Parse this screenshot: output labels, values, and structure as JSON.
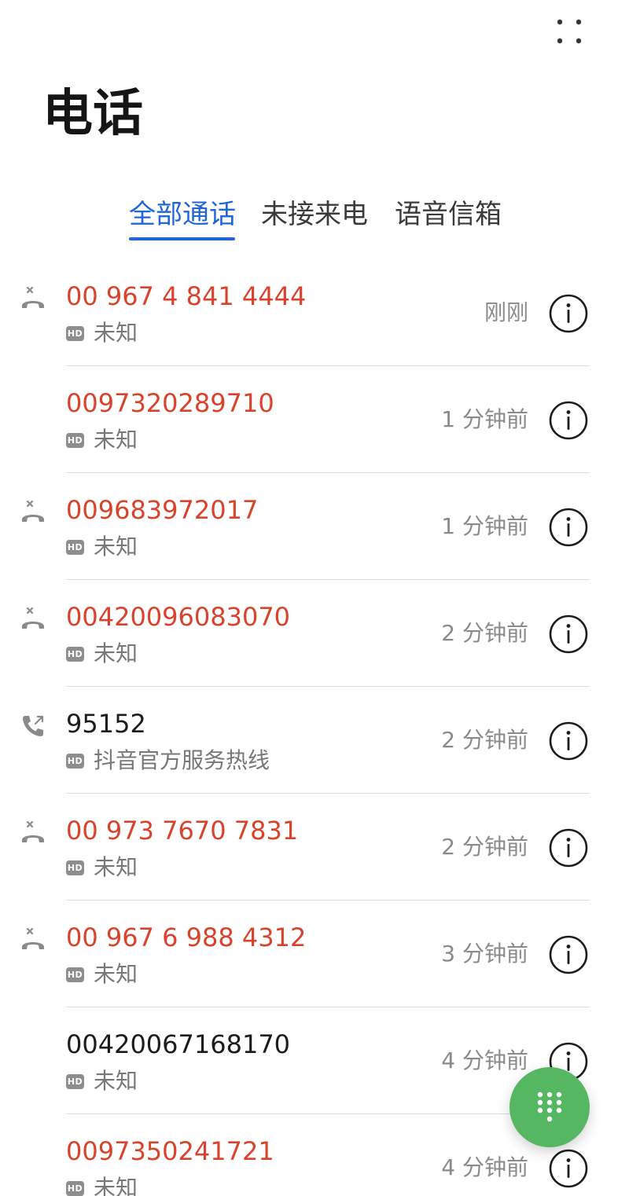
{
  "header": {
    "title": "电话"
  },
  "tabs": [
    {
      "label": "全部通话",
      "active": true
    },
    {
      "label": "未接来电",
      "active": false
    },
    {
      "label": "语音信箱",
      "active": false
    }
  ],
  "hd_badge": "HD",
  "calls": [
    {
      "number": "00 967 4 841 4444",
      "label": "未知",
      "time": "刚刚",
      "type": "missed",
      "missed": true
    },
    {
      "number": "0097320289710",
      "label": "未知",
      "time": "1 分钟前",
      "type": "none",
      "missed": true
    },
    {
      "number": "009683972017",
      "label": "未知",
      "time": "1 分钟前",
      "type": "missed",
      "missed": true
    },
    {
      "number": "00420096083070",
      "label": "未知",
      "time": "2 分钟前",
      "type": "missed",
      "missed": true
    },
    {
      "number": "95152",
      "label": "抖音官方服务热线",
      "time": "2 分钟前",
      "type": "outgoing",
      "missed": false
    },
    {
      "number": "00 973 7670 7831",
      "label": "未知",
      "time": "2 分钟前",
      "type": "missed",
      "missed": true
    },
    {
      "number": "00 967 6 988 4312",
      "label": "未知",
      "time": "3 分钟前",
      "type": "missed",
      "missed": true
    },
    {
      "number": "00420067168170",
      "label": "未知",
      "time": "4 分钟前",
      "type": "none",
      "missed": false
    },
    {
      "number": "0097350241721",
      "label": "未知",
      "time": "4 分钟前",
      "type": "none",
      "missed": true
    }
  ],
  "colors": {
    "accent": "#1f66d6",
    "missed": "#d9432c",
    "fab": "#56b763"
  },
  "icons": {
    "menu": "more-dots-icon",
    "missed_call": "missed-call-icon",
    "outgoing_call": "outgoing-call-icon",
    "info": "info-icon",
    "dialpad": "dialpad-icon"
  }
}
